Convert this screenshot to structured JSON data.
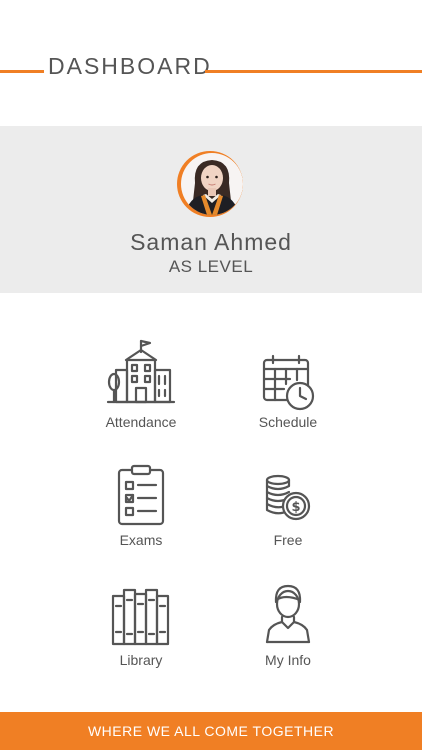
{
  "header": {
    "title": "DASHBOARD"
  },
  "profile": {
    "name": "Saman Ahmed",
    "level": "AS LEVEL"
  },
  "menu": {
    "attendance": "Attendance",
    "schedule": "Schedule",
    "exams": "Exams",
    "free": "Free",
    "library": "Library",
    "my_info": "My Info"
  },
  "footer": {
    "tagline": "WHERE WE ALL COME TOGETHER"
  },
  "colors": {
    "accent": "#f07f24",
    "panel": "#ececec",
    "text": "#555555"
  }
}
